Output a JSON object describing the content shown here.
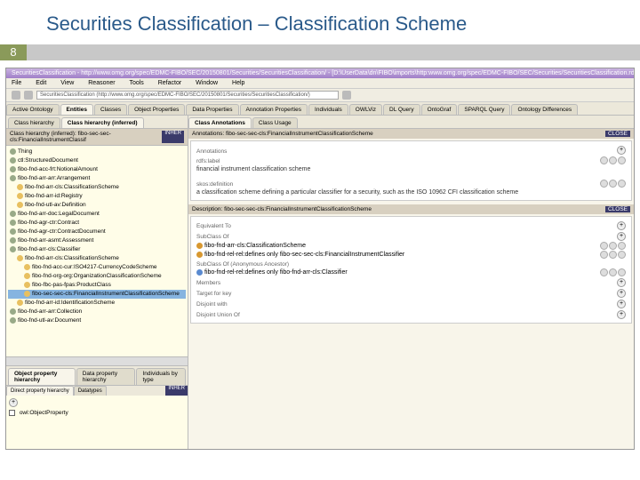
{
  "slide": {
    "title": "Securities Classification – Classification Scheme",
    "number": "8"
  },
  "window": {
    "title": "SecuritiesClassification - http://www.omg.org/spec/EDMC-FIBO/SEC/20150801/Securities/SecuritiesClassification/ - [D:\\UserData\\dn\\FIBO\\imports\\http:www.omg.org/spec/EDMC-FIBO/SEC/Securities/SecuritiesClassification.rdf]"
  },
  "menu": [
    "File",
    "Edit",
    "View",
    "Reasoner",
    "Tools",
    "Refactor",
    "Window",
    "Help"
  ],
  "url": "SecuritiesClassification (http://www.omg.org/spec/EDMC-FIBO/SEC/20150801/Securities/SecuritiesClassification/)",
  "mainTabs": [
    "Active Ontology",
    "Entities",
    "Classes",
    "Object Properties",
    "Data Properties",
    "Annotation Properties",
    "Individuals",
    "OWLViz",
    "DL Query",
    "OntoGraf",
    "SPARQL Query",
    "Ontology Differences"
  ],
  "mainActive": 1,
  "hierarchyTab": "Class hierarchy (inferred)",
  "hdrLeft": "Class hierarchy (inferred): fibo-sec-sec-cls:FinancialInstrumentClassif",
  "hdrTag": "INHER",
  "tree": [
    {
      "l": 0,
      "t": "Thing"
    },
    {
      "l": 0,
      "t": "ctl:StructuredDocument"
    },
    {
      "l": 0,
      "t": "fibo-fnd-acc-frt:NotionalAmount"
    },
    {
      "l": 0,
      "t": "fibo-fnd-arr-arr:Arrangement"
    },
    {
      "l": 1,
      "t": "fibo-fnd-arr-cls:ClassificationScheme"
    },
    {
      "l": 1,
      "t": "fibo-fnd-arr-id:Registry"
    },
    {
      "l": 1,
      "t": "fibo-fnd-utl-av:Definition"
    },
    {
      "l": 0,
      "t": "fibo-fnd-arr-doc:LegalDocument"
    },
    {
      "l": 0,
      "t": "fibo-fnd-agr-ctr:Contract"
    },
    {
      "l": 0,
      "t": "fibo-fnd-agr-ctr:ContractDocument"
    },
    {
      "l": 0,
      "t": "fibo-fnd-arr-asmt:Assessment"
    },
    {
      "l": 0,
      "t": "fibo-fnd-arr-cls:Classifier"
    },
    {
      "l": 1,
      "t": "fibo-fnd-arr-cls:ClassificationScheme"
    },
    {
      "l": 2,
      "t": "fibo-fnd-acc-cur:ISO4217-CurrencyCodeScheme"
    },
    {
      "l": 2,
      "t": "fibo-fnd-org-org:OrganizationClassificationScheme"
    },
    {
      "l": 2,
      "t": "fibo-fbc-pas-fpas:ProductClass"
    },
    {
      "l": 2,
      "t": "fibo-sec-sec-cls:FinancialInstrumentClassificationScheme",
      "sel": true
    },
    {
      "l": 1,
      "t": "fibo-fnd-arr-id:IdentificationScheme"
    },
    {
      "l": 0,
      "t": "fibo-fnd-arr-arr:Collection"
    },
    {
      "l": 0,
      "t": "fibo-fnd-utl-av:Document"
    }
  ],
  "subTabs": [
    "Object property hierarchy",
    "Data property hierarchy",
    "Individuals by type"
  ],
  "subTabs2": [
    "Direct property hierarchy",
    "Datatypes"
  ],
  "subTag": "INHER",
  "addLabel": "",
  "instance": "owl:ObjectProperty",
  "rightTabs": [
    "Class Annotations",
    "Class Usage"
  ],
  "annotHdr": "Annotations: fibo-sec-sec-cls:FinancialInstrumentClassificationScheme",
  "annotTag": "CLOSE",
  "fields": {
    "annotationsLabel": "Annotations",
    "rdfsLabel": "rdfs:label",
    "rdfsValue": "financial instrument classification scheme",
    "skosLabel": "skos:definition",
    "skosValue": "a classification scheme defining a particular classifier for a security, such as the ISO 10962 CFI classification scheme"
  },
  "descHdr": "Description: fibo-sec-sec-cls:FinancialInstrumentClassificationScheme",
  "descTag": "CLOSE",
  "desc": {
    "equivLabel": "Equivalent To",
    "subLabel": "SubClass Of",
    "sub1": "fibo-fnd-arr-cls:ClassificationScheme",
    "sub2": "fibo-fnd-rel-rel:defines only fibo-sec-sec-cls:FinancialInstrumentClassifier",
    "anonLabel": "SubClass Of (Anonymous Ancestor)",
    "anon1": "fibo-fnd-rel-rel:defines only fibo-fnd-arr-cls:Classifier",
    "membersLabel": "Members",
    "targetLabel": "Target for key",
    "disjointLabel": "Disjoint with",
    "unionLabel": "Disjoint Union Of"
  }
}
